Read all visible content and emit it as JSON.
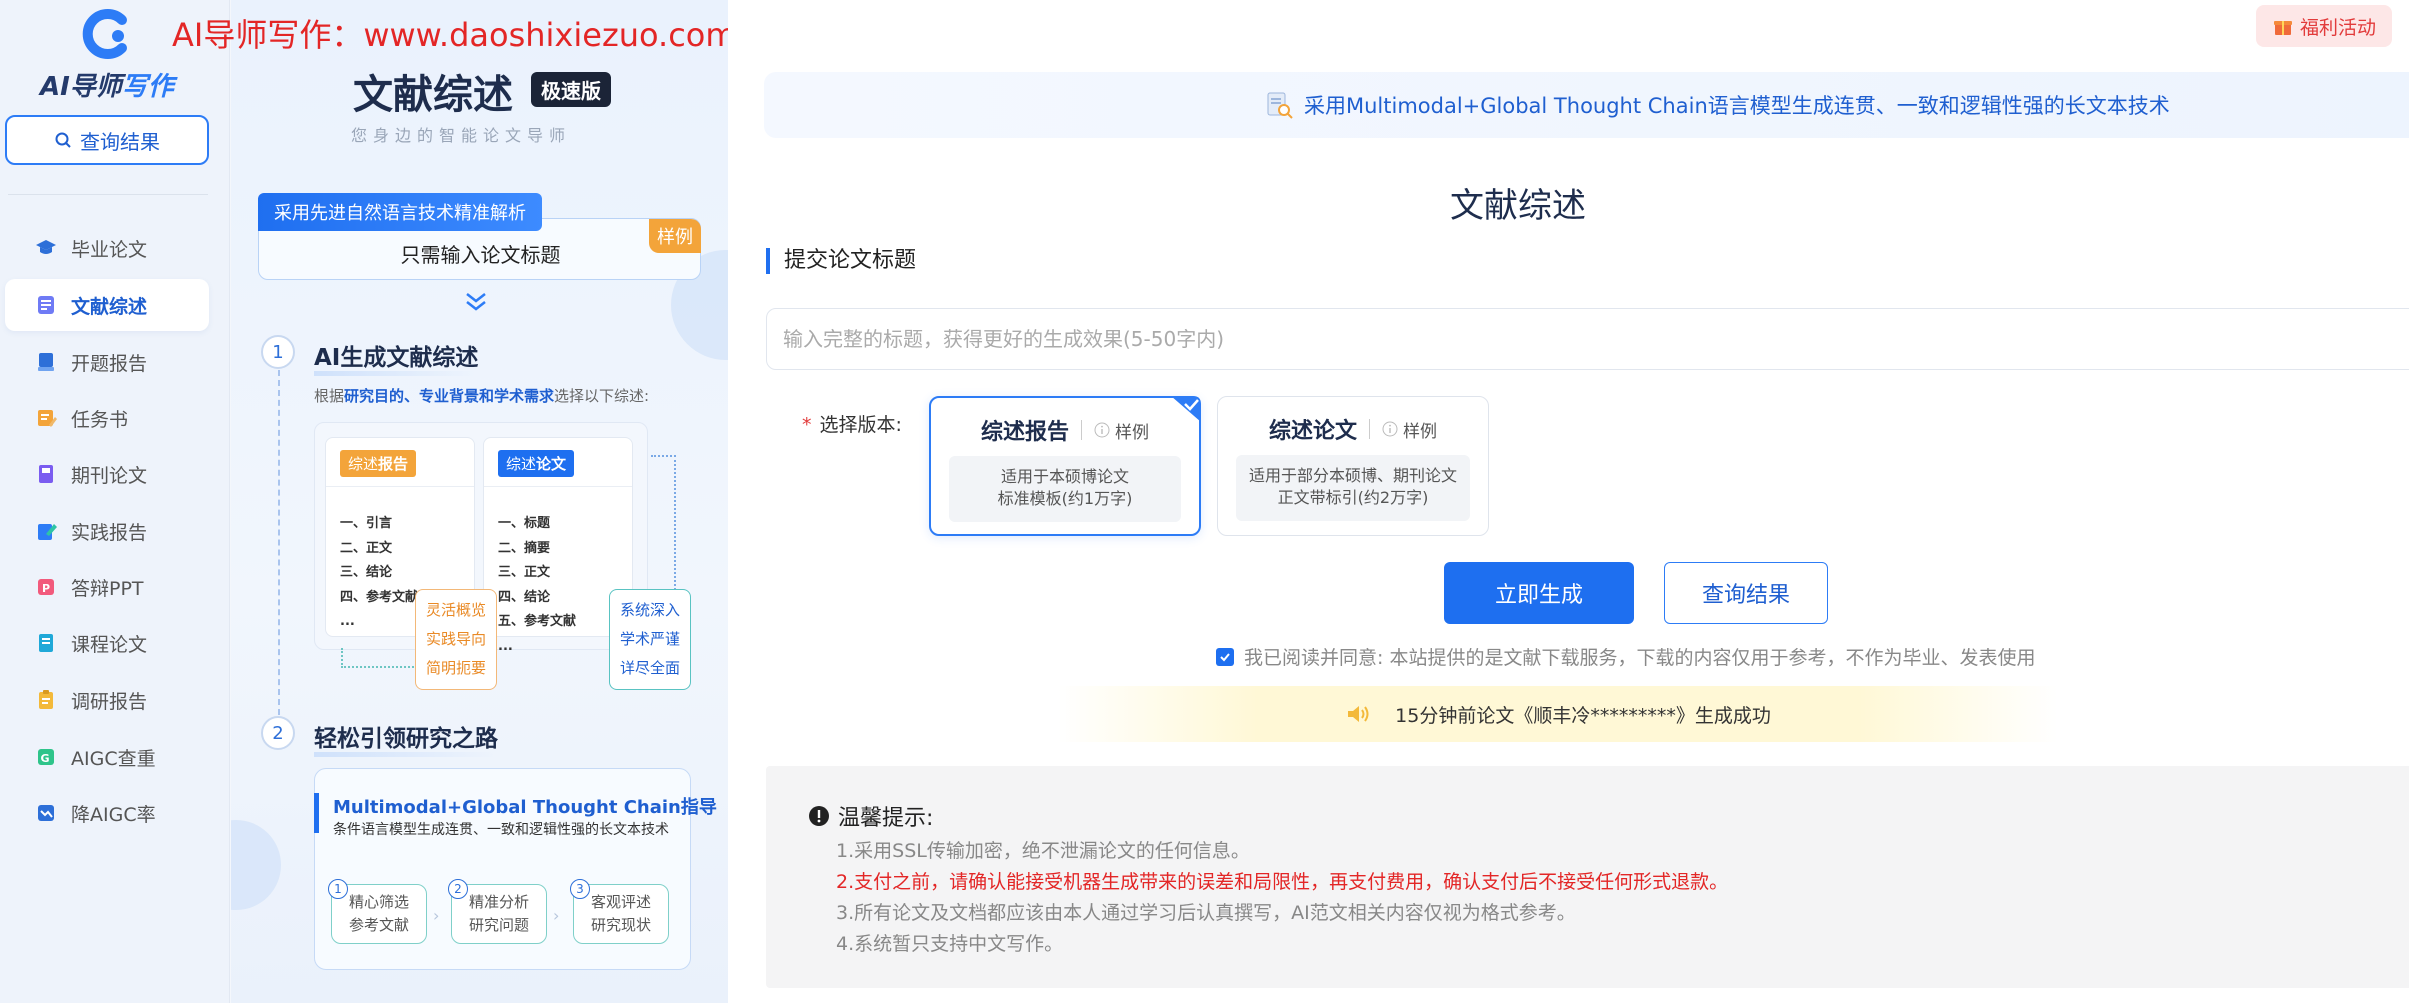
{
  "watermark": "AI导师写作：www.daoshixiezuo.com",
  "sidebar": {
    "logo_main": "AI导师",
    "logo_accent": "写作",
    "query_button": "查询结果",
    "items": [
      {
        "label": "毕业论文",
        "icon": "graduation-cap-icon",
        "active": false
      },
      {
        "label": "文献综述",
        "icon": "document-list-icon",
        "active": true
      },
      {
        "label": "开题报告",
        "icon": "book-stack-icon",
        "active": false
      },
      {
        "label": "任务书",
        "icon": "task-edit-icon",
        "active": false
      },
      {
        "label": "期刊论文",
        "icon": "journal-icon",
        "active": false
      },
      {
        "label": "实践报告",
        "icon": "practice-edit-icon",
        "active": false
      },
      {
        "label": "答辩PPT",
        "icon": "ppt-icon",
        "active": false
      },
      {
        "label": "课程论文",
        "icon": "course-doc-icon",
        "active": false
      },
      {
        "label": "调研报告",
        "icon": "survey-clipboard-icon",
        "active": false
      },
      {
        "label": "AIGC查重",
        "icon": "aigc-check-icon",
        "active": false
      },
      {
        "label": "降AIGC率",
        "icon": "reduce-chart-icon",
        "active": false
      }
    ]
  },
  "promo": {
    "title": "文献综述",
    "badge": "极速版",
    "subtitle": "您身边的智能论文导师",
    "hint_tag": "采用先进自然语言技术精准解析",
    "hint_text": "只需输入论文标题",
    "sample_tag": "样例",
    "step1": {
      "num": "1",
      "title": "AI生成文献综述",
      "desc_prefix": "根据",
      "desc_highlight": "研究目的、专业背景和学术需求",
      "desc_suffix": "选择以下综述:",
      "card_report": {
        "tag_prefix": "综述",
        "tag_strong": "报告",
        "items": [
          "一、引言",
          "二、正文",
          "三、结论",
          "四、参考文献",
          "..."
        ]
      },
      "card_paper": {
        "tag_prefix": "综述",
        "tag_strong": "论文",
        "items": [
          "一、标题",
          "二、摘要",
          "三、正文",
          "四、结论",
          "五、参考文献",
          "..."
        ]
      },
      "features_left": [
        "灵活概览",
        "实践导向",
        "简明扼要"
      ],
      "features_right": [
        "系统深入",
        "学术严谨",
        "详尽全面"
      ]
    },
    "step2": {
      "num": "2",
      "title": "轻松引领研究之路",
      "card_head": "Multimodal+Global Thought Chain指导",
      "card_sub": "条件语言模型生成连贯、一致和逻辑性强的长文本技术",
      "pills": [
        {
          "n": "1",
          "line1": "精心筛选",
          "line2": "参考文献"
        },
        {
          "n": "2",
          "line1": "精准分析",
          "line2": "研究问题"
        },
        {
          "n": "3",
          "line1": "客观评述",
          "line2": "研究现状"
        }
      ]
    }
  },
  "main": {
    "welfare": "福利活动",
    "banner": "采用Multimodal+Global Thought Chain语言模型生成连贯、一致和逻辑性强的长文本技术",
    "title": "文献综述",
    "section_head": "提交论文标题",
    "input_placeholder": "输入完整的标题，获得更好的生成效果(5-50字内)",
    "input_value": "",
    "version_label": "选择版本:",
    "versions": [
      {
        "name": "综述报告",
        "sample": "样例",
        "desc1": "适用于本硕博论文",
        "desc2": "标准模板(约1万字)",
        "selected": true
      },
      {
        "name": "综述论文",
        "sample": "样例",
        "desc1": "适用于部分本硕博、期刊论文",
        "desc2": "正文带标引(约2万字)",
        "selected": false
      }
    ],
    "generate_button": "立即生成",
    "result_button": "查询结果",
    "agree_text": "我已阅读并同意: 本站提供的是文献下载服务，下载的内容仅用于参考，不作为毕业、发表使用",
    "agree_checked": true,
    "ticker": "15分钟前论文《顺丰冷*********》生成成功",
    "tips": {
      "head": "温馨提示:",
      "items": [
        "1.采用SSL传输加密，绝不泄漏论文的任何信息。",
        "2.支付之前，请确认能接受机器生成带来的误差和局限性，再支付费用，确认支付后不接受任何形式退款。",
        "3.所有论文及文档都应该由本人通过学习后认真撰写，AI范文相关内容仅视为格式参考。",
        "4.系统暂只支持中文写作。"
      ]
    }
  },
  "colors": {
    "accent": "#1e6ff0",
    "warning": "#e32626",
    "orange": "#f3a43a"
  }
}
